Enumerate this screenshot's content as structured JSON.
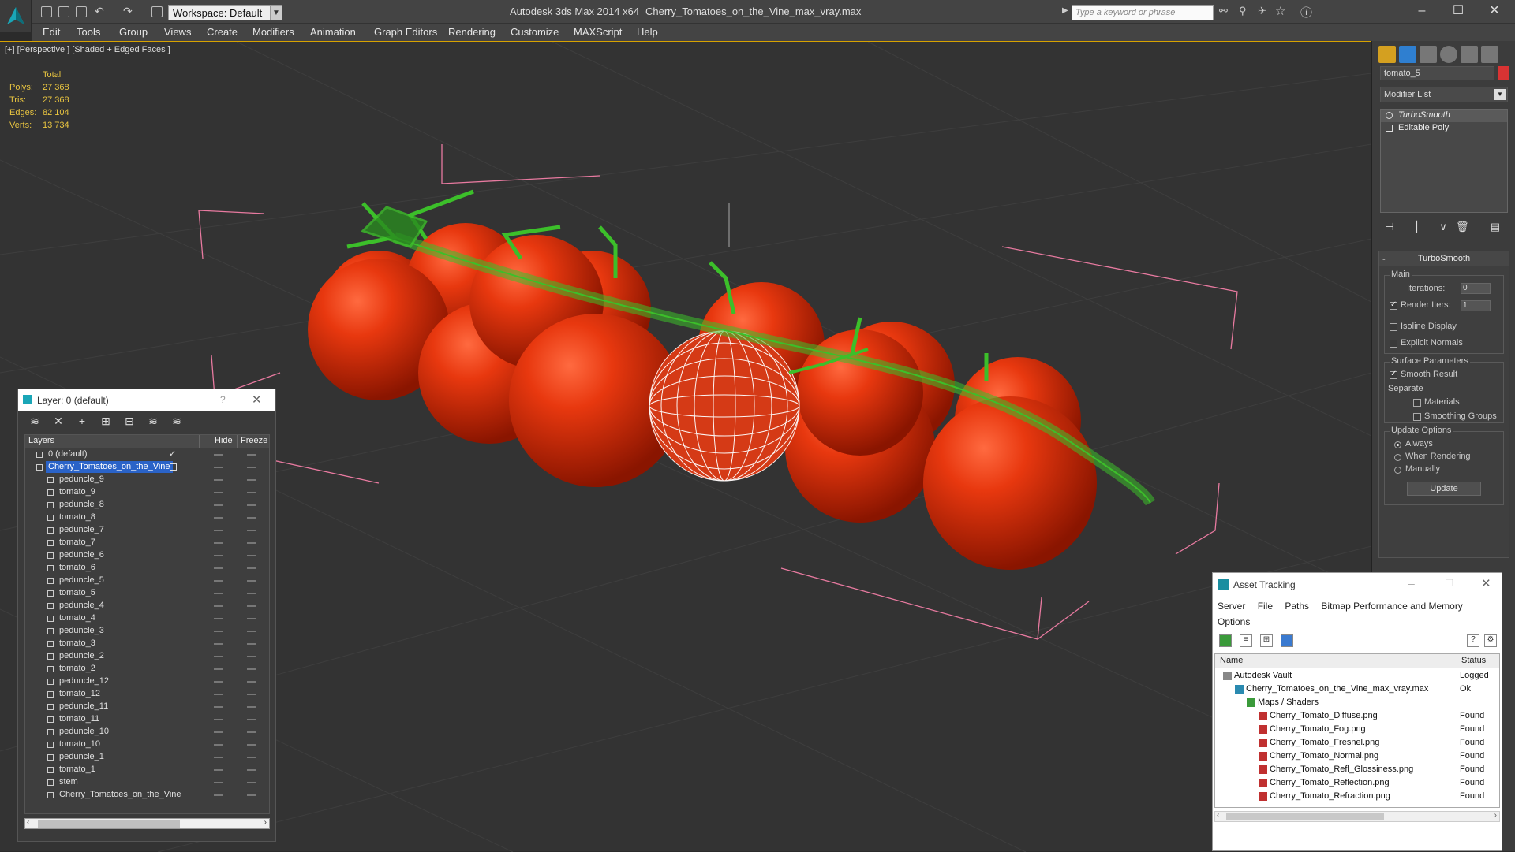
{
  "titlebar": {
    "workspace": "Workspace: Default",
    "app_title": "Autodesk 3ds Max  2014 x64",
    "file_title": "Cherry_Tomatoes_on_the_Vine_max_vray.max",
    "search_placeholder": "Type a keyword or phrase"
  },
  "menu": [
    "Edit",
    "Tools",
    "Group",
    "Views",
    "Create",
    "Modifiers",
    "Animation",
    "Graph Editors",
    "Rendering",
    "Customize",
    "MAXScript",
    "Help"
  ],
  "viewport": {
    "label": "[+] [Perspective ] [Shaded + Edged Faces ]",
    "stats_header": "Total",
    "stats": [
      {
        "label": "Polys:",
        "value": "27 368"
      },
      {
        "label": "Tris:",
        "value": "27 368"
      },
      {
        "label": "Edges:",
        "value": "82 104"
      },
      {
        "label": "Verts:",
        "value": "13 734"
      }
    ]
  },
  "command_panel": {
    "object_name": "tomato_5",
    "object_color": "#d93333",
    "modifier_list": "Modifier List",
    "stack": [
      "TurboSmooth",
      "Editable Poly"
    ],
    "rollout_title": "TurboSmooth",
    "main_group": "Main",
    "iterations_label": "Iterations:",
    "iterations_value": "0",
    "render_iters_label": "Render Iters:",
    "render_iters_value": "1",
    "isoline": "Isoline Display",
    "explicit_normals": "Explicit Normals",
    "surface_group": "Surface Parameters",
    "smooth_result": "Smooth Result",
    "separate": "Separate",
    "materials": "Materials",
    "smoothing_groups": "Smoothing Groups",
    "update_group": "Update Options",
    "always": "Always",
    "when_rendering": "When Rendering",
    "manually": "Manually",
    "update_button": "Update"
  },
  "layer_dialog": {
    "title": "Layer: 0 (default)",
    "col_layers": "Layers",
    "col_hide": "Hide",
    "col_freeze": "Freeze",
    "rows": [
      {
        "name": "0 (default)",
        "level": 1,
        "type": "layer"
      },
      {
        "name": "Cherry_Tomatoes_on_the_Vine",
        "level": 1,
        "type": "layer",
        "selected": true
      },
      {
        "name": "peduncle_9",
        "level": 2
      },
      {
        "name": "tomato_9",
        "level": 2
      },
      {
        "name": "peduncle_8",
        "level": 2
      },
      {
        "name": "tomato_8",
        "level": 2
      },
      {
        "name": "peduncle_7",
        "level": 2
      },
      {
        "name": "tomato_7",
        "level": 2
      },
      {
        "name": "peduncle_6",
        "level": 2
      },
      {
        "name": "tomato_6",
        "level": 2
      },
      {
        "name": "peduncle_5",
        "level": 2
      },
      {
        "name": "tomato_5",
        "level": 2
      },
      {
        "name": "peduncle_4",
        "level": 2
      },
      {
        "name": "tomato_4",
        "level": 2
      },
      {
        "name": "peduncle_3",
        "level": 2
      },
      {
        "name": "tomato_3",
        "level": 2
      },
      {
        "name": "peduncle_2",
        "level": 2
      },
      {
        "name": "tomato_2",
        "level": 2
      },
      {
        "name": "peduncle_12",
        "level": 2
      },
      {
        "name": "tomato_12",
        "level": 2
      },
      {
        "name": "peduncle_11",
        "level": 2
      },
      {
        "name": "tomato_11",
        "level": 2
      },
      {
        "name": "peduncle_10",
        "level": 2
      },
      {
        "name": "tomato_10",
        "level": 2
      },
      {
        "name": "peduncle_1",
        "level": 2
      },
      {
        "name": "tomato_1",
        "level": 2
      },
      {
        "name": "stem",
        "level": 2
      },
      {
        "name": "Cherry_Tomatoes_on_the_Vine",
        "level": 2
      }
    ]
  },
  "asset_dialog": {
    "title": "Asset Tracking",
    "menu": [
      "Server",
      "File",
      "Paths",
      "Bitmap Performance and Memory",
      "Options"
    ],
    "col_name": "Name",
    "col_status": "Status",
    "rows": [
      {
        "name": "Autodesk Vault",
        "status": "Logged",
        "level": 0,
        "kind": "vault"
      },
      {
        "name": "Cherry_Tomatoes_on_the_Vine_max_vray.max",
        "status": "Ok",
        "level": 1,
        "kind": "max"
      },
      {
        "name": "Maps / Shaders",
        "status": "",
        "level": 2,
        "kind": "folder"
      },
      {
        "name": "Cherry_Tomato_Diffuse.png",
        "status": "Found",
        "level": 3,
        "kind": "png"
      },
      {
        "name": "Cherry_Tomato_Fog.png",
        "status": "Found",
        "level": 3,
        "kind": "png"
      },
      {
        "name": "Cherry_Tomato_Fresnel.png",
        "status": "Found",
        "level": 3,
        "kind": "png"
      },
      {
        "name": "Cherry_Tomato_Normal.png",
        "status": "Found",
        "level": 3,
        "kind": "png"
      },
      {
        "name": "Cherry_Tomato_Refl_Glossiness.png",
        "status": "Found",
        "level": 3,
        "kind": "png"
      },
      {
        "name": "Cherry_Tomato_Reflection.png",
        "status": "Found",
        "level": 3,
        "kind": "png"
      },
      {
        "name": "Cherry_Tomato_Refraction.png",
        "status": "Found",
        "level": 3,
        "kind": "png"
      }
    ]
  }
}
